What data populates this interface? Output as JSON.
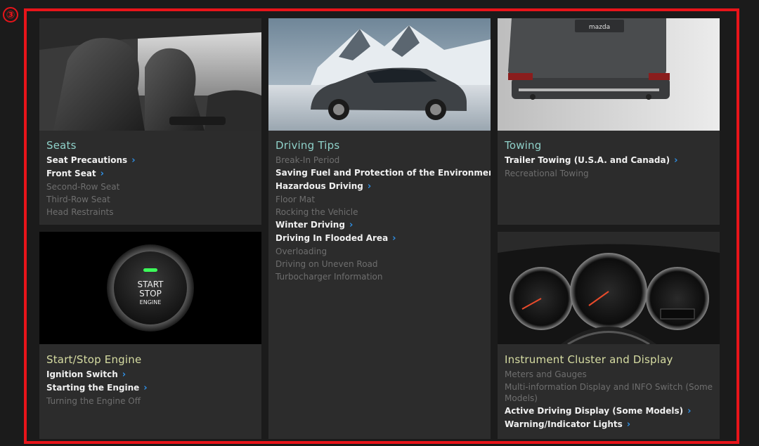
{
  "marker": "③",
  "cards": {
    "seats": {
      "title": "Seats",
      "items": [
        {
          "label": "Seat Precautions",
          "active": true
        },
        {
          "label": "Front Seat",
          "active": true
        },
        {
          "label": "Second-Row Seat",
          "active": false
        },
        {
          "label": "Third-Row Seat",
          "active": false
        },
        {
          "label": "Head Restraints",
          "active": false
        }
      ]
    },
    "driving_tips": {
      "title": "Driving Tips",
      "items": [
        {
          "label": "Break-In Period",
          "active": false
        },
        {
          "label": "Saving Fuel and Protection of the Environment",
          "active": true
        },
        {
          "label": "Hazardous Driving",
          "active": true
        },
        {
          "label": "Floor Mat",
          "active": false
        },
        {
          "label": "Rocking the Vehicle",
          "active": false
        },
        {
          "label": "Winter Driving",
          "active": true
        },
        {
          "label": "Driving In Flooded Area",
          "active": true
        },
        {
          "label": "Overloading",
          "active": false
        },
        {
          "label": "Driving on Uneven Road",
          "active": false
        },
        {
          "label": "Turbocharger Information",
          "active": false
        }
      ]
    },
    "towing": {
      "title": "Towing",
      "badge": "mazda",
      "items": [
        {
          "label": "Trailer Towing (U.S.A. and Canada)",
          "active": true
        },
        {
          "label": "Recreational Towing",
          "active": false
        }
      ]
    },
    "start_stop": {
      "title": "Start/Stop Engine",
      "button_text": {
        "line1": "START",
        "line2": "STOP",
        "line3": "ENGINE"
      },
      "items": [
        {
          "label": "Ignition Switch",
          "active": true
        },
        {
          "label": "Starting the Engine",
          "active": true
        },
        {
          "label": "Turning the Engine Off",
          "active": false
        }
      ]
    },
    "instrument": {
      "title": "Instrument Cluster and Display",
      "items": [
        {
          "label": "Meters and Gauges",
          "active": false
        },
        {
          "label": "Multi-information Display and INFO Switch (Some Models)",
          "active": false
        },
        {
          "label": "Active Driving Display (Some Models)",
          "active": true
        },
        {
          "label": "Warning/Indicator Lights",
          "active": true
        }
      ]
    }
  },
  "chevron": "›",
  "colors": {
    "frame": "#e8141a",
    "chevron": "#2f8fe3",
    "title": "#8fd1c9",
    "title_alt": "#d6dca2"
  }
}
